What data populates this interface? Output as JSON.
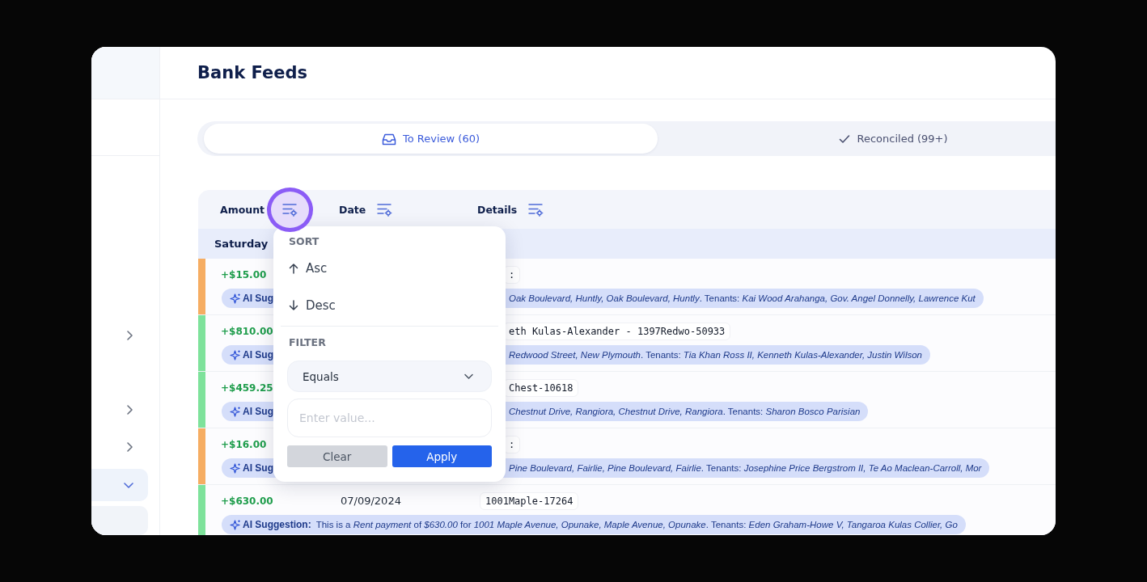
{
  "sidebar": {
    "items": [
      {
        "expanded": false
      },
      {
        "expanded": false
      },
      {
        "expanded": false
      },
      {
        "expanded": true,
        "selected": true,
        "children": [
          {
            "selected": false
          }
        ]
      }
    ]
  },
  "page": {
    "title": "Bank Feeds"
  },
  "tabs": [
    {
      "label": "To Review (60)",
      "selected": true,
      "kind": "inbox"
    },
    {
      "label": "Reconciled (99+)",
      "selected": false,
      "kind": "check"
    }
  ],
  "table": {
    "columns": [
      {
        "label": "Amount",
        "filter_open": true
      },
      {
        "label": "Date",
        "filter_open": false
      },
      {
        "label": "Details",
        "filter_open": false
      }
    ],
    "group": {
      "label": "Saturday"
    },
    "rows": [
      {
        "color": "#f6ad62",
        "amount": "+$15.00",
        "details": ":",
        "suggestion": {
          "label": "AI Sug",
          "text": "*Oak Boulevard, Huntly, Oak Boulevard, Huntly*. Tenants: *Kai Wood Arahanga, Gov. Angel Donnelly, Lawrence Kut*"
        }
      },
      {
        "color": "#7ee29b",
        "amount": "+$810.00",
        "details": "eth Kulas-Alexander - 1397Redwo-50933",
        "suggestion": {
          "label": "AI Sug",
          "text": "*Redwood Street, New Plymouth*. Tenants: *Tia Khan Ross II, Kenneth Kulas-Alexander, Justin Wilson*"
        }
      },
      {
        "color": "#7ee29b",
        "amount": "+$459.25",
        "details": "Chest-10618",
        "suggestion": {
          "label": "AI Sug",
          "text": "*Chestnut Drive, Rangiora, Chestnut Drive, Rangiora*. Tenants: *Sharon Bosco Parisian*"
        }
      },
      {
        "color": "#f6ad62",
        "amount": "+$16.00",
        "details": ":",
        "suggestion": {
          "label": "AI Sug",
          "text": "*Pine Boulevard, Fairlie, Pine Boulevard, Fairlie*. Tenants: *Josephine Price Bergstrom II, Te Ao Maclean-Carroll, Mor*"
        }
      },
      {
        "color": "#7ee29b",
        "amount": "+$630.00",
        "date": "07/09/2024",
        "details": "1001Maple-17264",
        "suggestion": {
          "label": "AI Suggestion:",
          "text": "This is a *Rent payment* of *$630.00* for *1001 Maple Avenue, Opunake, Maple Avenue, Opunake*. Tenants: *Eden Graham-Howe V, Tangaroa Kulas Collier, Go*"
        }
      }
    ]
  },
  "filter_menu": {
    "sort_heading": "SORT",
    "sort_options": [
      {
        "label": "Asc",
        "kind": "asc"
      },
      {
        "label": "Desc",
        "kind": "desc"
      }
    ],
    "filter_heading": "FILTER",
    "operator": "Equals",
    "value_placeholder": "Enter value...",
    "buttons": [
      {
        "label": "Clear",
        "kind": "secondary"
      },
      {
        "label": "Apply",
        "kind": "primary"
      }
    ]
  }
}
